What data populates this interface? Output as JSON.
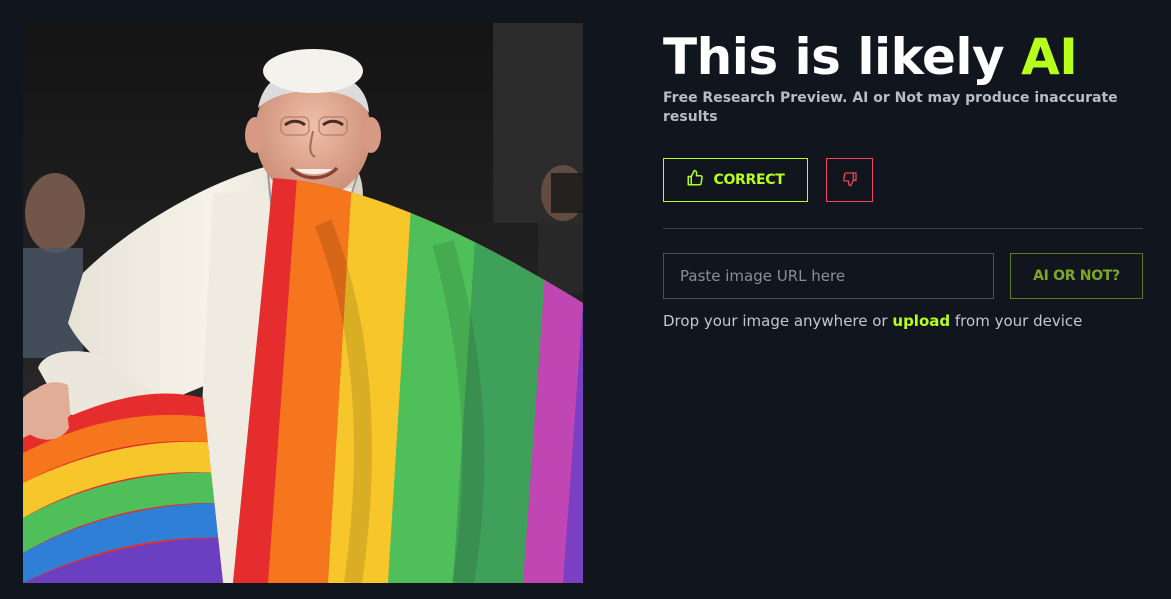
{
  "verdict": {
    "prefix": "This is likely",
    "result": "AI"
  },
  "subtitle": "Free Research Preview. AI or Not may produce inaccurate results",
  "feedback": {
    "correct_label": "CORRECT",
    "correct_icon": "thumbs-up-icon",
    "wrong_icon": "thumbs-down-icon"
  },
  "url_input": {
    "placeholder": "Paste image URL here",
    "value": ""
  },
  "check_button_label": "AI OR NOT?",
  "drop_hint": {
    "before": "Drop your image anywhere or",
    "link": "upload",
    "after": "from your device"
  },
  "colors": {
    "background": "#11151d",
    "accent": "#b7ff1c",
    "danger": "#f0445c",
    "muted_green": "#7fa624"
  }
}
